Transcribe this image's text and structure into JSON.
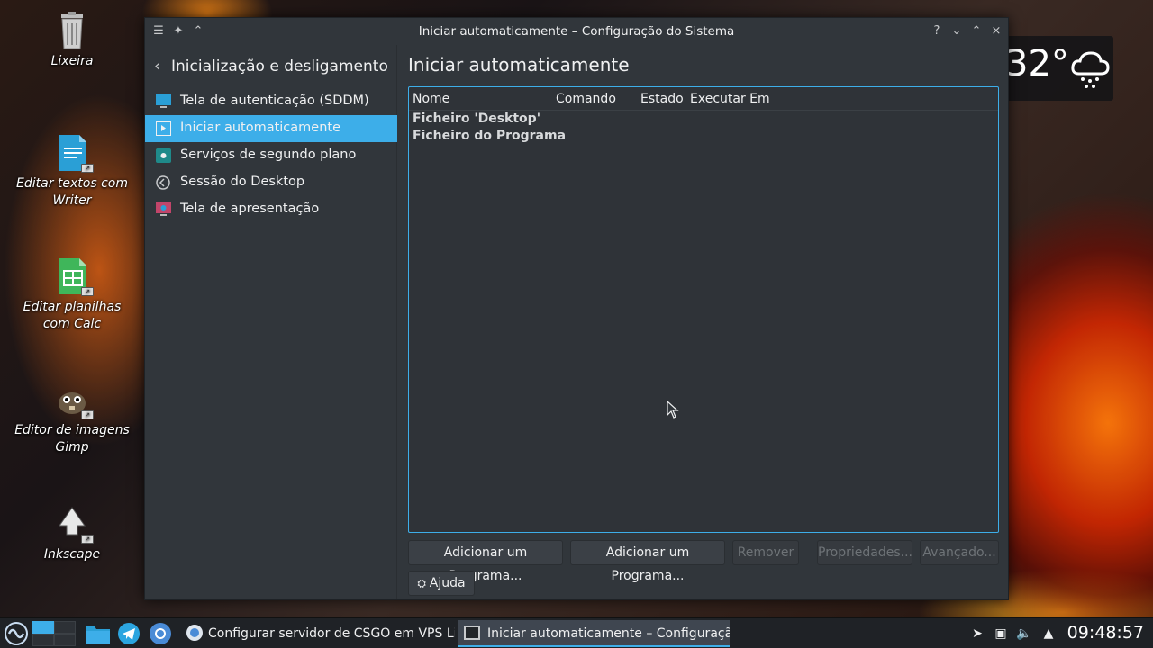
{
  "desktop": {
    "icons": [
      {
        "label": "Lixeira"
      },
      {
        "label": "Editar textos com Writer"
      },
      {
        "label": "Editar planilhas com Calc"
      },
      {
        "label": "Editor de imagens Gimp"
      },
      {
        "label": "Inkscape"
      }
    ],
    "weather": {
      "temp": "32°",
      "icon": "rain-cloud-icon"
    }
  },
  "window": {
    "title": "Iniciar automaticamente – Configuração do Sistema",
    "controls": {
      "help": "?",
      "minimize": "⌄",
      "maximize": "⌃",
      "close": "×"
    },
    "sidebar": {
      "back_label": "Inicialização e desligamento",
      "items": [
        {
          "label": "Tela de autenticação (SDDM)"
        },
        {
          "label": "Iniciar automaticamente"
        },
        {
          "label": "Serviços de segundo plano"
        },
        {
          "label": "Sessão do Desktop"
        },
        {
          "label": "Tela de apresentação"
        }
      ]
    },
    "main": {
      "heading": "Iniciar automaticamente",
      "columns": [
        "Nome",
        "Comando",
        "Estado",
        "Executar Em"
      ],
      "rows": [
        "Ficheiro 'Desktop'",
        "Ficheiro do Programa"
      ],
      "buttons": {
        "add_program": "Adicionar um Programa...",
        "add_script": "Adicionar um Programa...",
        "remove": "Remover",
        "properties": "Propriedades...",
        "advanced": "Avançado...",
        "help": "Ajuda"
      }
    }
  },
  "taskbar": {
    "tasks": [
      {
        "label": "Configurar servidor de CSGO em VPS Li..."
      },
      {
        "label": "Iniciar automaticamente  – Configuraçã..."
      }
    ],
    "clock": "09:48:57"
  },
  "colors": {
    "accent": "#3daee9",
    "window_bg": "#31363b",
    "taskbar_bg": "#1f2226"
  }
}
